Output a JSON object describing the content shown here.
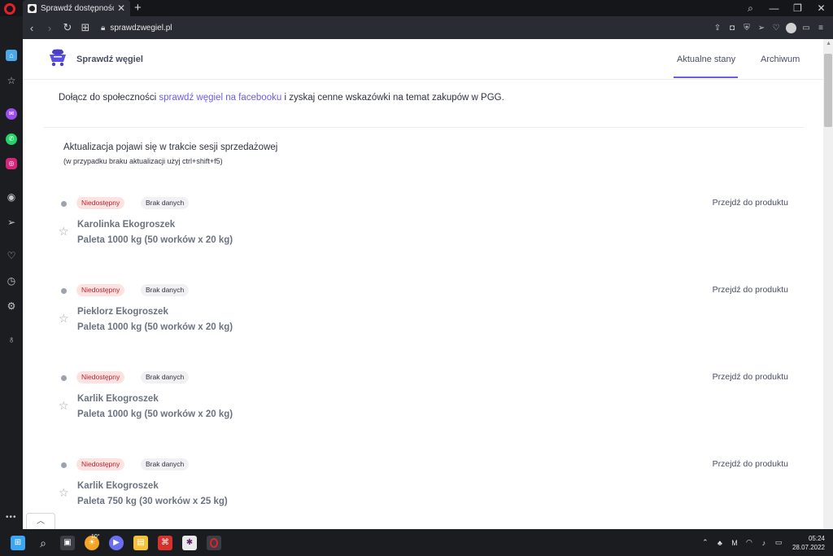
{
  "browser": {
    "tab_title": "Sprawdź dostępność węgla",
    "url": "sprawdzwegiel.pl"
  },
  "site": {
    "brand": "Sprawdź węgiel",
    "nav": {
      "current": "Aktualne stany",
      "archive": "Archiwum"
    },
    "accent_color": "#6c5ce7"
  },
  "intro": {
    "before_link": "Dołącz do społeczności ",
    "link_text": "sprawdź węgiel na facebooku",
    "after_link": " i zyskaj cenne wskazówki na temat zakupów w PGG."
  },
  "update_notice": {
    "title": "Aktualizacja pojawi się w trakcie sesji sprzedażowej",
    "subtitle": "(w przypadku braku aktualizacji użyj ctrl+shift+f5)"
  },
  "products": [
    {
      "status": "Niedostępny",
      "info": "Brak danych",
      "link": "Przejdź do produktu",
      "name": "Karolinka Ekogroszek",
      "package": "Paleta 1000 kg (50 worków x 20 kg)"
    },
    {
      "status": "Niedostępny",
      "info": "Brak danych",
      "link": "Przejdź do produktu",
      "name": "Pieklorz Ekogroszek",
      "package": "Paleta 1000 kg (50 worków x 20 kg)"
    },
    {
      "status": "Niedostępny",
      "info": "Brak danych",
      "link": "Przejdź do produktu",
      "name": "Karlik Ekogroszek",
      "package": "Paleta 1000 kg (50 worków x 20 kg)"
    },
    {
      "status": "Niedostępny",
      "info": "Brak danych",
      "link": "Przejdź do produktu",
      "name": "Karlik Ekogroszek",
      "package": "Paleta 750 kg (30 worków x 25 kg)"
    }
  ],
  "taskbar": {
    "temperature": "10°",
    "time": "05:24",
    "date": "28.07.2022"
  }
}
